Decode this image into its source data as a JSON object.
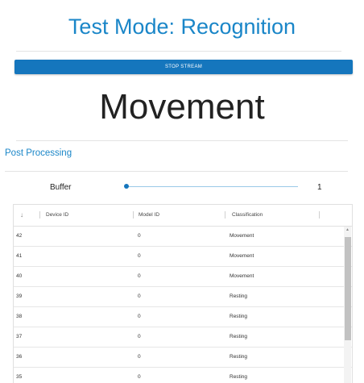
{
  "header": {
    "title": "Test Mode: Recognition"
  },
  "stream_button": {
    "label": "STOP STREAM"
  },
  "result": {
    "label": "Movement"
  },
  "post_processing": {
    "title": "Post Processing",
    "buffer_label": "Buffer",
    "buffer_value": "1",
    "slider_fraction": 0.0
  },
  "table": {
    "sort_icon": "↓",
    "columns": [
      "Device ID",
      "Model ID",
      "Classification"
    ],
    "rows": [
      {
        "device_id": "42",
        "model_id": "0",
        "classification": "Movement"
      },
      {
        "device_id": "41",
        "model_id": "0",
        "classification": "Movement"
      },
      {
        "device_id": "40",
        "model_id": "0",
        "classification": "Movement"
      },
      {
        "device_id": "39",
        "model_id": "0",
        "classification": "Resting"
      },
      {
        "device_id": "38",
        "model_id": "0",
        "classification": "Resting"
      },
      {
        "device_id": "37",
        "model_id": "0",
        "classification": "Resting"
      },
      {
        "device_id": "36",
        "model_id": "0",
        "classification": "Resting"
      },
      {
        "device_id": "35",
        "model_id": "0",
        "classification": "Resting"
      }
    ]
  },
  "colors": {
    "accent": "#1a86c8",
    "button": "#1576bd"
  }
}
